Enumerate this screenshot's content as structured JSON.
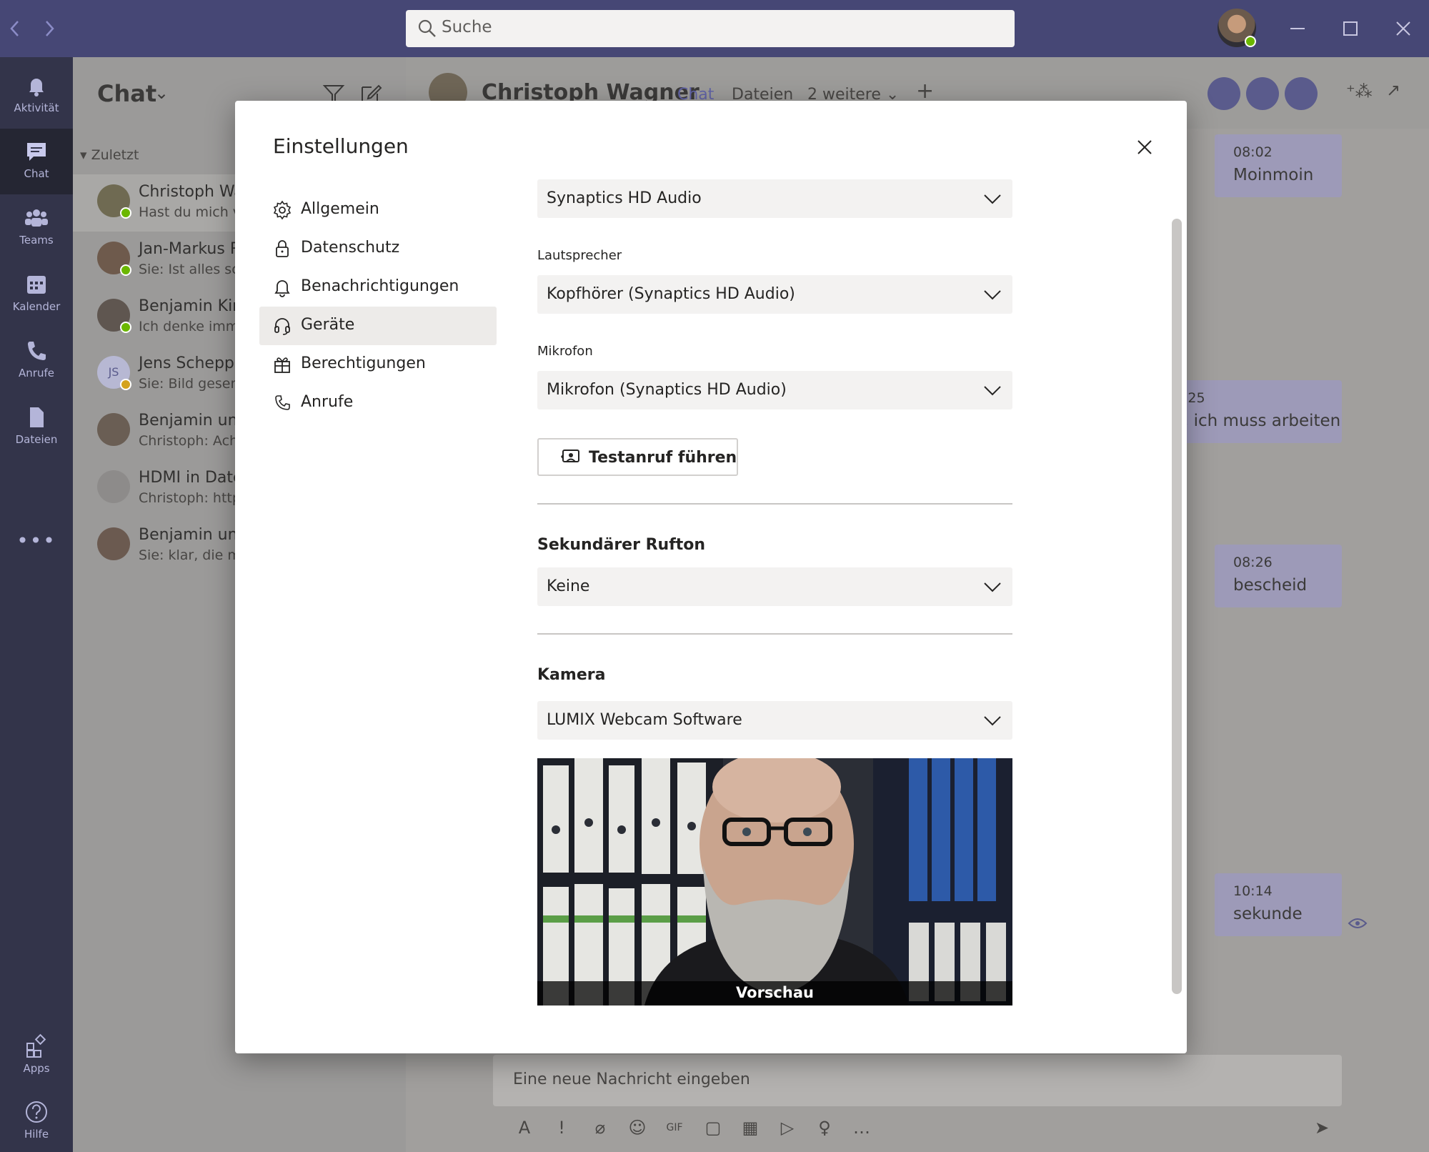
{
  "titlebar": {
    "back_icon": "chevron-left-icon",
    "forward_icon": "chevron-right-icon",
    "search_placeholder": "Suche",
    "window_controls": [
      "minimize-icon",
      "maximize-icon",
      "close-icon"
    ]
  },
  "rail": {
    "items": [
      {
        "label": "Aktivität",
        "icon": "bell-icon"
      },
      {
        "label": "Chat",
        "icon": "chat-icon",
        "active": true
      },
      {
        "label": "Teams",
        "icon": "teams-icon"
      },
      {
        "label": "Kalender",
        "icon": "calendar-icon"
      },
      {
        "label": "Anrufe",
        "icon": "phone-icon"
      },
      {
        "label": "Dateien",
        "icon": "file-icon"
      }
    ],
    "bottom": [
      {
        "label": "Apps",
        "icon": "apps-icon"
      },
      {
        "label": "Hilfe",
        "icon": "help-icon"
      }
    ]
  },
  "chatlist": {
    "title": "Chat",
    "section": "Zuletzt",
    "rows": [
      {
        "name": "Christoph Wa",
        "sub": "Hast du mich ve"
      },
      {
        "name": "Jan-Markus R",
        "sub": "Sie: Ist alles sch"
      },
      {
        "name": "Benjamin Kirc",
        "sub": "Ich denke imme"
      },
      {
        "name": "Jens Schepple",
        "sub": "Sie: Bild gesend",
        "initials": "JS"
      },
      {
        "name": "Benjamin und",
        "sub": "Christoph: Achj"
      },
      {
        "name": "HDMI in Date",
        "sub": "Christoph: https"
      },
      {
        "name": "Benjamin und",
        "sub": "Sie: klar, die ma"
      }
    ]
  },
  "conversation": {
    "name": "Christoph Wagner",
    "tabs": [
      "Chat",
      "Dateien",
      "2 weitere"
    ],
    "messages": [
      {
        "time": "08:02",
        "text": "Moinmoin"
      },
      {
        "time": ":25",
        "text": ", ich muss arbeiten"
      },
      {
        "time": "08:26",
        "text": "bescheid"
      },
      {
        "time": "10:14",
        "text": "sekunde"
      }
    ],
    "compose_placeholder": "Eine neue Nachricht eingeben"
  },
  "settings": {
    "title": "Einstellungen",
    "menu": [
      {
        "label": "Allgemein",
        "icon": "gear-icon"
      },
      {
        "label": "Datenschutz",
        "icon": "lock-icon"
      },
      {
        "label": "Benachrichtigungen",
        "icon": "bell-icon"
      },
      {
        "label": "Geräte",
        "icon": "headset-icon",
        "active": true
      },
      {
        "label": "Berechtigungen",
        "icon": "gift-icon"
      },
      {
        "label": "Anrufe",
        "icon": "phone-icon"
      }
    ],
    "devices": {
      "audio_device": "Synaptics HD Audio",
      "speaker_label": "Lautsprecher",
      "speaker_value": "Kopfhörer (Synaptics HD Audio)",
      "mic_label": "Mikrofon",
      "mic_value": "Mikrofon (Synaptics HD Audio)",
      "test_call": "Testanruf führen",
      "secondary_ring_title": "Sekundärer Rufton",
      "secondary_ring_value": "Keine",
      "camera_title": "Kamera",
      "camera_value": "LUMIX Webcam Software",
      "preview_caption": "Vorschau"
    }
  },
  "colors": {
    "titlebar": "#464775",
    "rail": "#33344a",
    "brand_purple": "#6264a7",
    "presence_green": "#6bb700"
  }
}
